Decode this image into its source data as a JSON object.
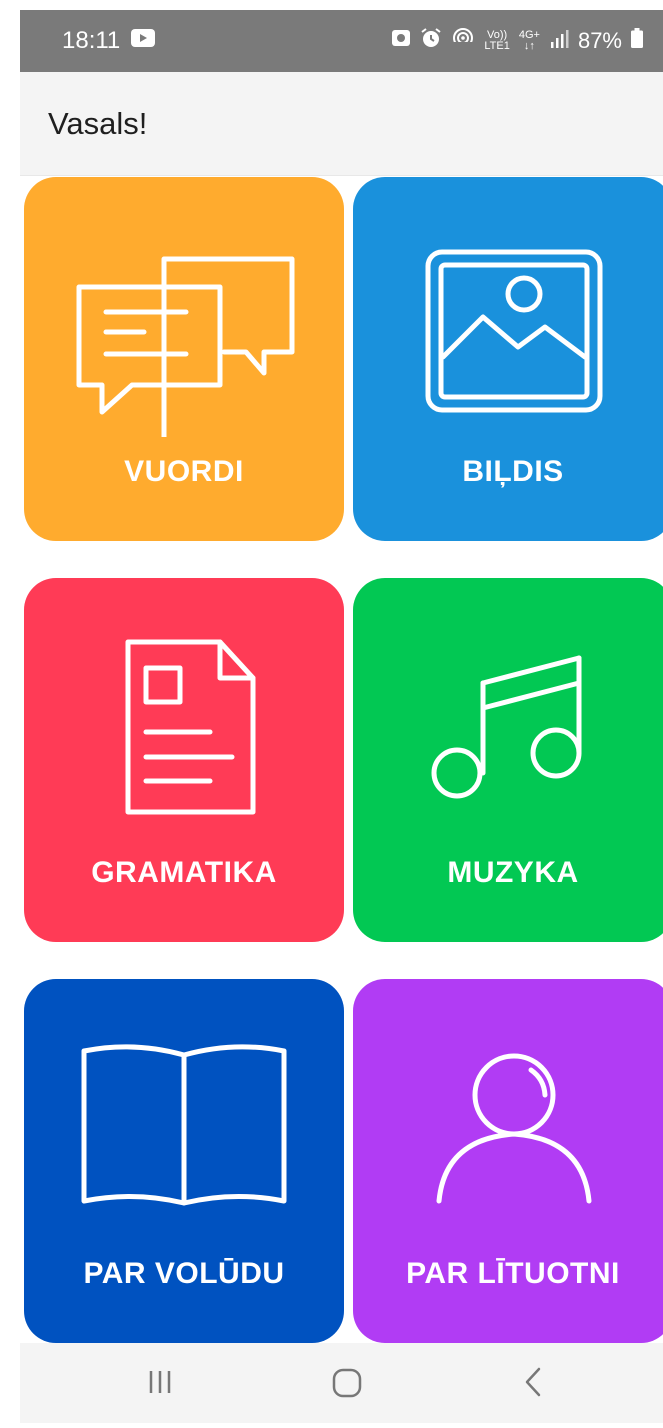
{
  "status_bar": {
    "time": "18:11",
    "volte_label": "Vo))\nLTE1",
    "network_label": "4G+\n↓↑",
    "battery_percent": "87%",
    "icons": [
      "youtube-icon",
      "photo-icon",
      "alarm-icon",
      "hotspot-icon",
      "signal-icon",
      "battery-icon"
    ]
  },
  "app_bar": {
    "title": "Vasals!"
  },
  "tiles": [
    {
      "label": "VUORDI",
      "icon": "speech-bubbles-icon",
      "color": "#ffab2e"
    },
    {
      "label": "BIĻDIS",
      "icon": "image-icon",
      "color": "#1a91dc"
    },
    {
      "label": "GRAMATIKA",
      "icon": "document-icon",
      "color": "#ff3b56"
    },
    {
      "label": "MUZYKA",
      "icon": "music-note-icon",
      "color": "#02c853"
    },
    {
      "label": "PAR VOLŪDU",
      "icon": "open-book-icon",
      "color": "#0052c0"
    },
    {
      "label": "PAR LĪTUOTNI",
      "icon": "user-icon",
      "color": "#b13cf4"
    }
  ],
  "nav_bar": {
    "buttons": [
      "recent-apps-icon",
      "home-icon",
      "back-icon"
    ]
  },
  "colors": {
    "status_bar": "#7a7a7a",
    "app_bar": "#f4f4f4",
    "nav_bar": "#f4f4f4",
    "icon_stroke": "#ffffff"
  }
}
